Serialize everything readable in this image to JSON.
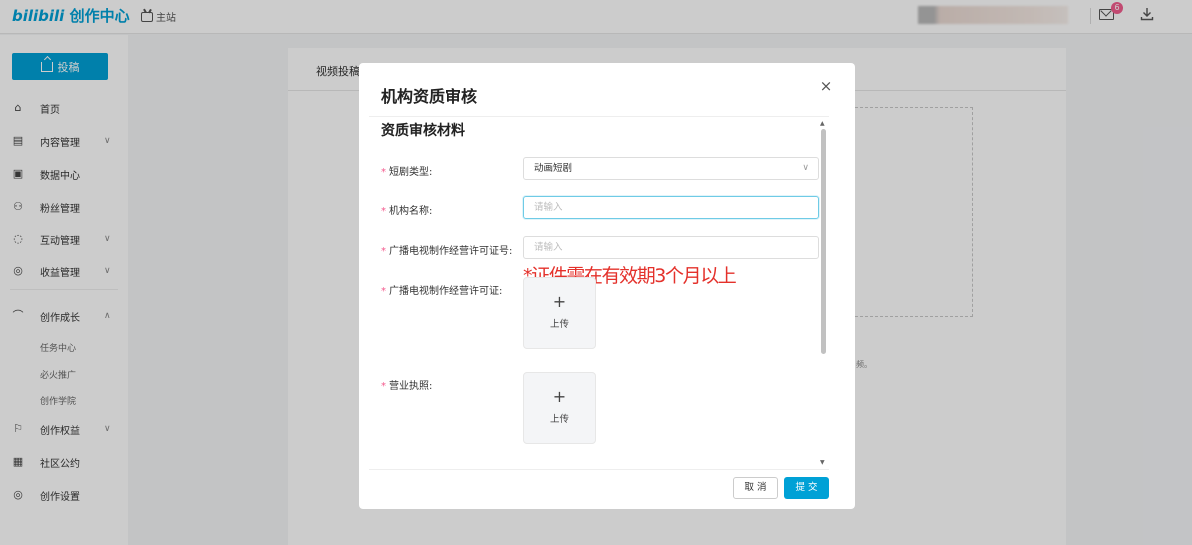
{
  "header": {
    "logo_bili": "bilibili",
    "logo_text": "创作中心",
    "main_site": "主站",
    "mail_badge": "6"
  },
  "sidebar": {
    "upload_label": "投稿",
    "items": [
      {
        "label": "首页",
        "icon": "home-icon"
      },
      {
        "label": "内容管理",
        "icon": "document-icon",
        "chevron": "∨"
      },
      {
        "label": "数据中心",
        "icon": "chart-icon"
      },
      {
        "label": "粉丝管理",
        "icon": "user-icon"
      },
      {
        "label": "互动管理",
        "icon": "chat-icon",
        "chevron": "∨"
      },
      {
        "label": "收益管理",
        "icon": "money-icon",
        "chevron": "∨"
      },
      {
        "label": "创作成长",
        "icon": "graduation-icon",
        "chevron": "∧"
      },
      {
        "label": "创作权益",
        "icon": "flag-icon",
        "chevron": "∨"
      },
      {
        "label": "社区公约",
        "icon": "rules-icon"
      },
      {
        "label": "创作设置",
        "icon": "settings-icon"
      }
    ],
    "sub_items": [
      "任务中心",
      "必火推广",
      "创作学院"
    ]
  },
  "content": {
    "tab_label": "视频投稿",
    "tiny_text": "频。"
  },
  "modal": {
    "title": "机构资质审核",
    "close": "×",
    "section_title": "资质审核材料",
    "fields": {
      "drama_type_label": "短剧类型:",
      "drama_type_value": "动画短剧",
      "org_name_label": "机构名称:",
      "org_name_placeholder": "请输入",
      "license_no_label": "广播电视制作经营许可证号:",
      "license_no_placeholder": "请输入",
      "license_label": "广播电视制作经营许可证:",
      "business_license_label": "营业执照:"
    },
    "note": "*证件需在有效期3个月以上",
    "upload_plus": "+",
    "upload_label": "上传",
    "cancel_label": "取 消",
    "submit_label": "提 交"
  },
  "colors": {
    "brand": "#00a1d6",
    "required": "#f45a8d",
    "note": "#e4312b"
  }
}
